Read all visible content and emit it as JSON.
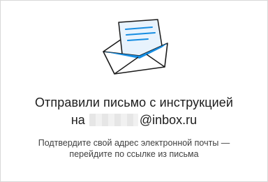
{
  "confirmation": {
    "title": "Отправили письмо с инструкцией",
    "email_prefix": "на",
    "email_domain": "@inbox.ru",
    "hint_line_1": "Подтвердите свой адрес электронной почты —",
    "hint_line_2": "перейдите по ссылке из письма"
  },
  "icons": {
    "illustration": "envelope-with-letter-icon"
  },
  "colors": {
    "accent": "#168de2",
    "text": "#1c1c1c"
  }
}
